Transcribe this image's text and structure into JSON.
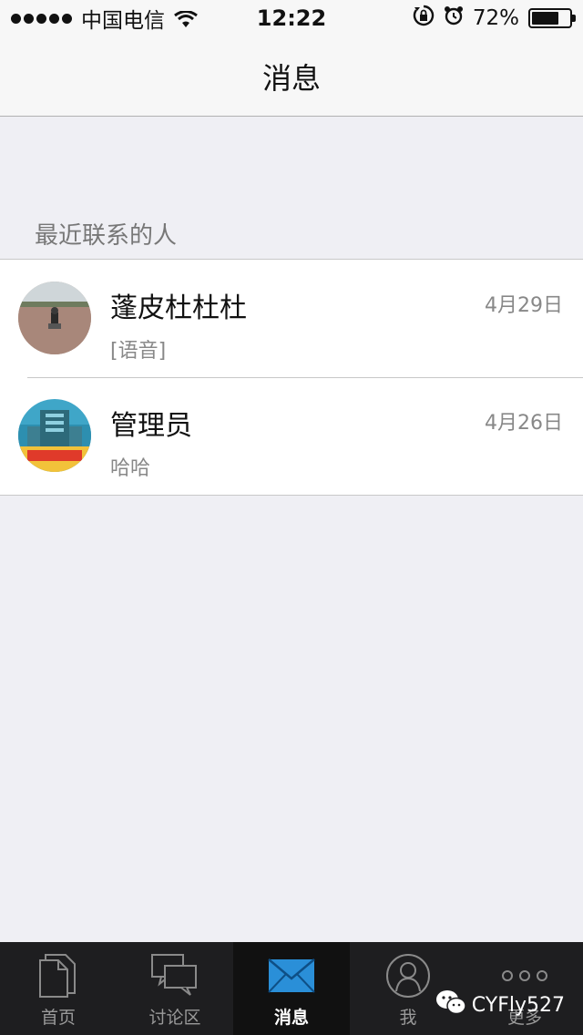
{
  "status_bar": {
    "carrier": "中国电信",
    "time": "12:22",
    "battery_percent": "72%",
    "battery_level": 0.72
  },
  "nav": {
    "title": "消息"
  },
  "section": {
    "header": "最近联系的人"
  },
  "contacts": [
    {
      "name": "蓬皮杜杜杜",
      "preview": "[语音]",
      "date": "4月29日"
    },
    {
      "name": "管理员",
      "preview": "哈哈",
      "date": "4月26日"
    }
  ],
  "tabs": [
    {
      "label": "首页",
      "icon": "document-icon",
      "active": false
    },
    {
      "label": "讨论区",
      "icon": "chat-bubbles-icon",
      "active": false
    },
    {
      "label": "消息",
      "icon": "envelope-icon",
      "active": true
    },
    {
      "label": "我",
      "icon": "user-icon",
      "active": false
    },
    {
      "label": "更多",
      "icon": "more-icon",
      "active": false
    }
  ],
  "watermark": {
    "text": "CYFly527"
  },
  "colors": {
    "accent": "#2a8fd8",
    "tab_bar": "#1e1e20",
    "background": "#efeff4"
  }
}
